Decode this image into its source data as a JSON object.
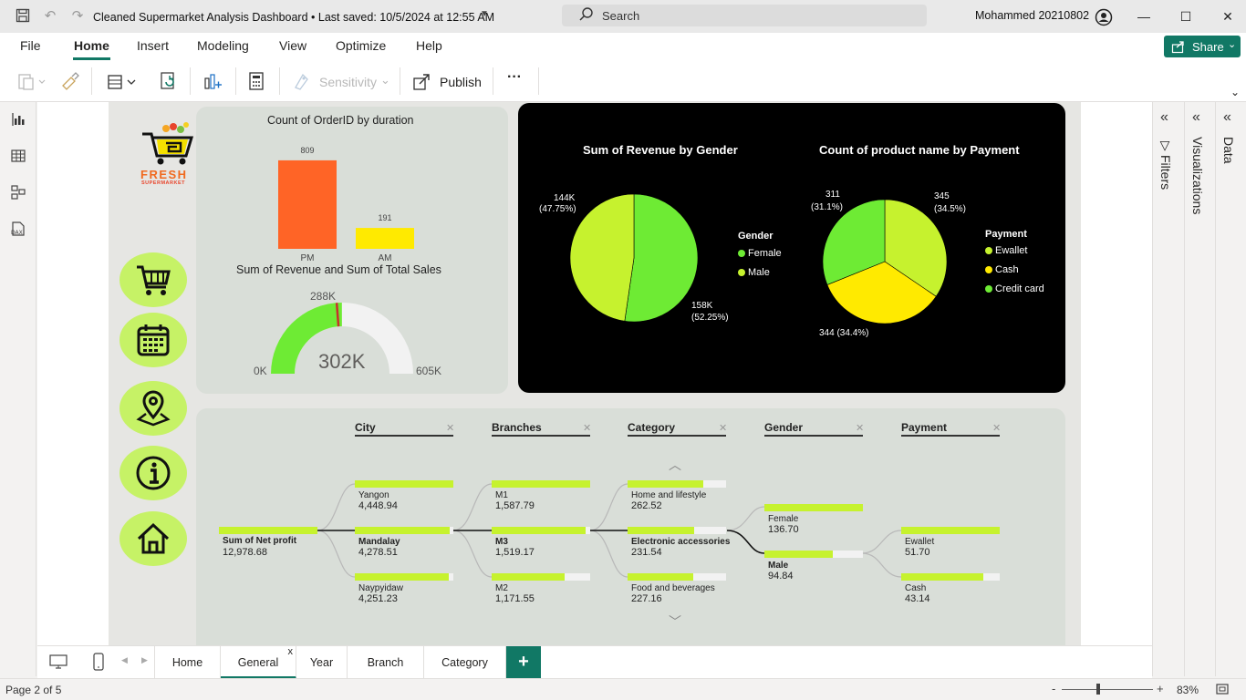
{
  "titlebar": {
    "title": "Cleaned Supermarket Analysis Dashboard • Last saved: 10/5/2024 at 12:55 AM",
    "search_placeholder": "Search",
    "user": "Mohammed 20210802"
  },
  "menu": {
    "items": [
      "File",
      "Home",
      "Insert",
      "Modeling",
      "View",
      "Optimize",
      "Help"
    ],
    "active": "Home",
    "share_label": "Share"
  },
  "ribbon": {
    "sensitivity_label": "Sensitivity",
    "publish_label": "Publish",
    "more_label": "···"
  },
  "panes": {
    "filters": "Filters",
    "visualizations": "Visualizations",
    "data": "Data"
  },
  "logo": {
    "text": "FRESH",
    "sub": "SUPERMARKET"
  },
  "tabs": [
    "Home",
    "General",
    "Year",
    "Branch",
    "Category"
  ],
  "active_tab": "General",
  "status": {
    "page": "Page 2 of 5",
    "zoom": "83%"
  },
  "colors": {
    "accent": "#117865",
    "lime": "#c6f22e",
    "green": "#6eeb34",
    "yellow": "#ffea00",
    "orange": "#ff6426"
  },
  "chart_data": [
    {
      "type": "bar",
      "title": "Count of OrderID by duration",
      "categories": [
        "PM",
        "AM"
      ],
      "values": [
        809,
        191
      ],
      "data_labels": [
        "809",
        "191"
      ],
      "colors": [
        "#ff6426",
        "#ffea00"
      ]
    },
    {
      "type": "gauge",
      "title": "Sum of Revenue and Sum of Total Sales",
      "value": 302,
      "value_label": "302K",
      "target": 288,
      "target_label": "288K",
      "min_label": "0K",
      "max_label": "605K",
      "min": 0,
      "max": 605
    },
    {
      "type": "pie",
      "title": "Sum of Revenue by Gender",
      "legend_title": "Gender",
      "slices": [
        {
          "name": "Female",
          "value": 158,
          "label": "158K",
          "pct": "(52.25%)",
          "color": "#6eeb34"
        },
        {
          "name": "Male",
          "value": 144,
          "label": "144K",
          "pct": "(47.75%)",
          "color": "#c6f22e"
        }
      ]
    },
    {
      "type": "pie",
      "title": "Count of product name by Payment",
      "legend_title": "Payment",
      "slices": [
        {
          "name": "Ewallet",
          "value": 345,
          "label": "345",
          "pct": "(34.5%)",
          "color": "#c6f22e"
        },
        {
          "name": "Cash",
          "value": 344,
          "label": "344 (34.4%)",
          "pct": "",
          "color": "#ffea00"
        },
        {
          "name": "Credit card",
          "value": 311,
          "label": "311",
          "pct": "(31.1%)",
          "color": "#6eeb34"
        }
      ]
    },
    {
      "type": "decomposition-tree",
      "root": {
        "label": "Sum of Net profit",
        "value": "12,978.68"
      },
      "levels": [
        "City",
        "Branches",
        "Category",
        "Gender",
        "Payment"
      ],
      "city": [
        {
          "label": "Yangon",
          "value": "4,448.94",
          "frac": 1.0
        },
        {
          "label": "Mandalay",
          "value": "4,278.51",
          "frac": 0.96,
          "selected": true
        },
        {
          "label": "Naypyidaw",
          "value": "4,251.23",
          "frac": 0.955
        }
      ],
      "branches": [
        {
          "label": "M1",
          "value": "1,587.79",
          "frac": 1.0
        },
        {
          "label": "M3",
          "value": "1,519.17",
          "frac": 0.957,
          "selected": true
        },
        {
          "label": "M2",
          "value": "1,171.55",
          "frac": 0.74
        }
      ],
      "category": [
        {
          "label": "Home and lifestyle",
          "value": "262.52",
          "frac": 0.77
        },
        {
          "label": "Electronic accessories",
          "value": "231.54",
          "frac": 0.68,
          "selected": true
        },
        {
          "label": "Food and beverages",
          "value": "227.16",
          "frac": 0.67
        }
      ],
      "gender": [
        {
          "label": "Female",
          "value": "136.70",
          "frac": 1.0
        },
        {
          "label": "Male",
          "value": "94.84",
          "frac": 0.69,
          "selected": true
        }
      ],
      "payment": [
        {
          "label": "Ewallet",
          "value": "51.70",
          "frac": 1.0
        },
        {
          "label": "Cash",
          "value": "43.14",
          "frac": 0.83
        }
      ]
    }
  ]
}
